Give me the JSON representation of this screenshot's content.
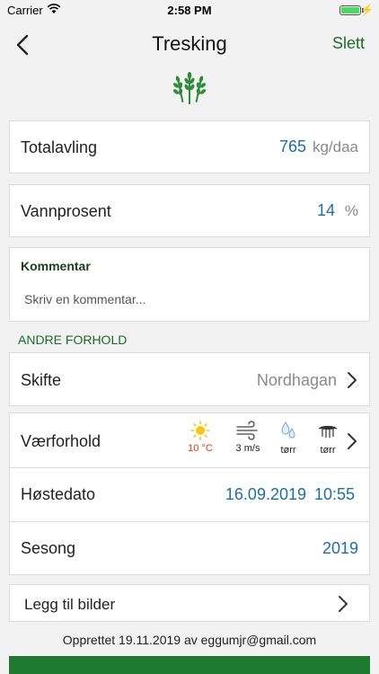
{
  "status_bar": {
    "carrier": "Carrier",
    "time": "2:58 PM",
    "battery_level": 1.0
  },
  "nav": {
    "title": "Tresking",
    "delete_label": "Slett",
    "back_icon": "chevron-left-icon"
  },
  "logo_icon": "wheat-icon",
  "total_yield": {
    "label": "Totalavling",
    "value": "765",
    "unit": "kg/daa"
  },
  "water_percent": {
    "label": "Vannprosent",
    "value": "14",
    "unit": "%"
  },
  "comment": {
    "title": "Kommentar",
    "placeholder": "Skriv en kommentar...",
    "value": ""
  },
  "section_other": "ANDRE FORHOLD",
  "field": {
    "label": "Skifte",
    "value": "Nordhagan"
  },
  "weather": {
    "label": "Værforhold",
    "items": [
      {
        "icon": "sun-icon",
        "label": "10 °C"
      },
      {
        "icon": "wind-icon",
        "label": "3 m/s"
      },
      {
        "icon": "rain-drops-icon",
        "label": "tørr"
      },
      {
        "icon": "soil-moisture-icon",
        "label": "tørr"
      }
    ]
  },
  "harvest_date": {
    "label": "Høstedato",
    "date": "16.09.2019",
    "time": "10:55"
  },
  "season": {
    "label": "Sesong",
    "value": "2019"
  },
  "add_photos": {
    "label": "Legg til bilder"
  },
  "created_text": "Opprettet 19.11.2019 av eggumjr@gmail.com",
  "colors": {
    "accent_green": "#1e6b2c",
    "value_blue": "#1f6f9e",
    "temp_red": "#d23a1e",
    "bottom_bar": "#1e7a30"
  }
}
